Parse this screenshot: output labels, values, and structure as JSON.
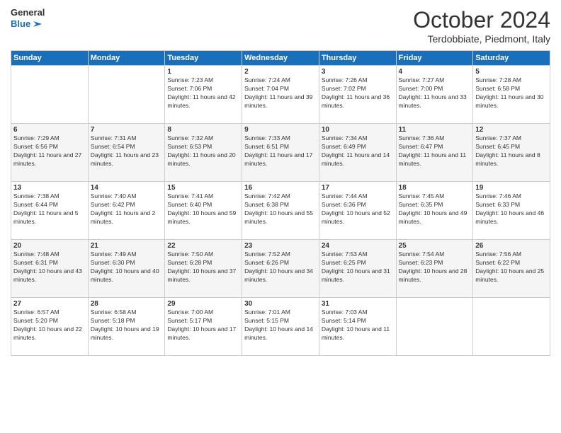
{
  "header": {
    "logo_line1": "General",
    "logo_line2": "Blue",
    "month": "October 2024",
    "location": "Terdobbiate, Piedmont, Italy"
  },
  "days_of_week": [
    "Sunday",
    "Monday",
    "Tuesday",
    "Wednesday",
    "Thursday",
    "Friday",
    "Saturday"
  ],
  "weeks": [
    [
      {
        "day": "",
        "info": ""
      },
      {
        "day": "",
        "info": ""
      },
      {
        "day": "1",
        "info": "Sunrise: 7:23 AM\nSunset: 7:06 PM\nDaylight: 11 hours and 42 minutes."
      },
      {
        "day": "2",
        "info": "Sunrise: 7:24 AM\nSunset: 7:04 PM\nDaylight: 11 hours and 39 minutes."
      },
      {
        "day": "3",
        "info": "Sunrise: 7:26 AM\nSunset: 7:02 PM\nDaylight: 11 hours and 36 minutes."
      },
      {
        "day": "4",
        "info": "Sunrise: 7:27 AM\nSunset: 7:00 PM\nDaylight: 11 hours and 33 minutes."
      },
      {
        "day": "5",
        "info": "Sunrise: 7:28 AM\nSunset: 6:58 PM\nDaylight: 11 hours and 30 minutes."
      }
    ],
    [
      {
        "day": "6",
        "info": "Sunrise: 7:29 AM\nSunset: 6:56 PM\nDaylight: 11 hours and 27 minutes."
      },
      {
        "day": "7",
        "info": "Sunrise: 7:31 AM\nSunset: 6:54 PM\nDaylight: 11 hours and 23 minutes."
      },
      {
        "day": "8",
        "info": "Sunrise: 7:32 AM\nSunset: 6:53 PM\nDaylight: 11 hours and 20 minutes."
      },
      {
        "day": "9",
        "info": "Sunrise: 7:33 AM\nSunset: 6:51 PM\nDaylight: 11 hours and 17 minutes."
      },
      {
        "day": "10",
        "info": "Sunrise: 7:34 AM\nSunset: 6:49 PM\nDaylight: 11 hours and 14 minutes."
      },
      {
        "day": "11",
        "info": "Sunrise: 7:36 AM\nSunset: 6:47 PM\nDaylight: 11 hours and 11 minutes."
      },
      {
        "day": "12",
        "info": "Sunrise: 7:37 AM\nSunset: 6:45 PM\nDaylight: 11 hours and 8 minutes."
      }
    ],
    [
      {
        "day": "13",
        "info": "Sunrise: 7:38 AM\nSunset: 6:44 PM\nDaylight: 11 hours and 5 minutes."
      },
      {
        "day": "14",
        "info": "Sunrise: 7:40 AM\nSunset: 6:42 PM\nDaylight: 11 hours and 2 minutes."
      },
      {
        "day": "15",
        "info": "Sunrise: 7:41 AM\nSunset: 6:40 PM\nDaylight: 10 hours and 59 minutes."
      },
      {
        "day": "16",
        "info": "Sunrise: 7:42 AM\nSunset: 6:38 PM\nDaylight: 10 hours and 55 minutes."
      },
      {
        "day": "17",
        "info": "Sunrise: 7:44 AM\nSunset: 6:36 PM\nDaylight: 10 hours and 52 minutes."
      },
      {
        "day": "18",
        "info": "Sunrise: 7:45 AM\nSunset: 6:35 PM\nDaylight: 10 hours and 49 minutes."
      },
      {
        "day": "19",
        "info": "Sunrise: 7:46 AM\nSunset: 6:33 PM\nDaylight: 10 hours and 46 minutes."
      }
    ],
    [
      {
        "day": "20",
        "info": "Sunrise: 7:48 AM\nSunset: 6:31 PM\nDaylight: 10 hours and 43 minutes."
      },
      {
        "day": "21",
        "info": "Sunrise: 7:49 AM\nSunset: 6:30 PM\nDaylight: 10 hours and 40 minutes."
      },
      {
        "day": "22",
        "info": "Sunrise: 7:50 AM\nSunset: 6:28 PM\nDaylight: 10 hours and 37 minutes."
      },
      {
        "day": "23",
        "info": "Sunrise: 7:52 AM\nSunset: 6:26 PM\nDaylight: 10 hours and 34 minutes."
      },
      {
        "day": "24",
        "info": "Sunrise: 7:53 AM\nSunset: 6:25 PM\nDaylight: 10 hours and 31 minutes."
      },
      {
        "day": "25",
        "info": "Sunrise: 7:54 AM\nSunset: 6:23 PM\nDaylight: 10 hours and 28 minutes."
      },
      {
        "day": "26",
        "info": "Sunrise: 7:56 AM\nSunset: 6:22 PM\nDaylight: 10 hours and 25 minutes."
      }
    ],
    [
      {
        "day": "27",
        "info": "Sunrise: 6:57 AM\nSunset: 5:20 PM\nDaylight: 10 hours and 22 minutes."
      },
      {
        "day": "28",
        "info": "Sunrise: 6:58 AM\nSunset: 5:18 PM\nDaylight: 10 hours and 19 minutes."
      },
      {
        "day": "29",
        "info": "Sunrise: 7:00 AM\nSunset: 5:17 PM\nDaylight: 10 hours and 17 minutes."
      },
      {
        "day": "30",
        "info": "Sunrise: 7:01 AM\nSunset: 5:15 PM\nDaylight: 10 hours and 14 minutes."
      },
      {
        "day": "31",
        "info": "Sunrise: 7:03 AM\nSunset: 5:14 PM\nDaylight: 10 hours and 11 minutes."
      },
      {
        "day": "",
        "info": ""
      },
      {
        "day": "",
        "info": ""
      }
    ]
  ]
}
